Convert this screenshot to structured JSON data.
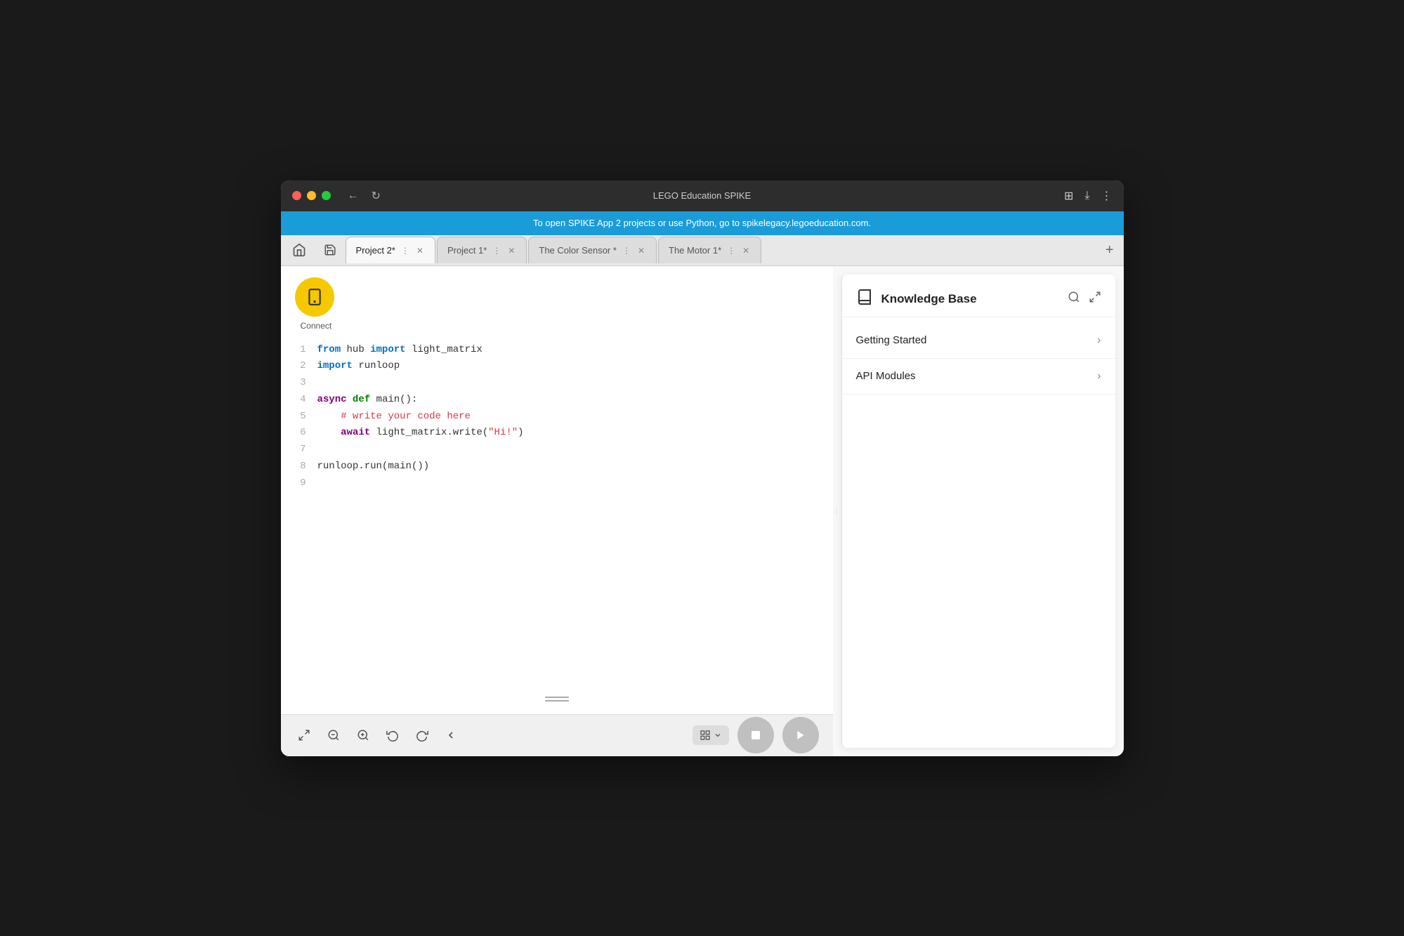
{
  "window": {
    "title": "LEGO Education SPIKE"
  },
  "banner": {
    "text": "To open SPIKE App 2 projects or use Python, go to spikelegacy.legoeducation.com."
  },
  "tabs": [
    {
      "label": "Project 2*",
      "active": true
    },
    {
      "label": "Project 1*",
      "active": false
    },
    {
      "label": "The Color Sensor *",
      "active": false
    },
    {
      "label": "The Motor 1*",
      "active": false
    }
  ],
  "connect": {
    "label": "Connect"
  },
  "code": {
    "lines": [
      {
        "num": "1",
        "content": "from hub import light_matrix"
      },
      {
        "num": "2",
        "content": "import runloop"
      },
      {
        "num": "3",
        "content": ""
      },
      {
        "num": "4",
        "content": "async def main():"
      },
      {
        "num": "5",
        "content": "    # write your code here"
      },
      {
        "num": "6",
        "content": "    await light_matrix.write(\"Hi!\")"
      },
      {
        "num": "7",
        "content": ""
      },
      {
        "num": "8",
        "content": "runloop.run(main())"
      },
      {
        "num": "9",
        "content": ""
      }
    ]
  },
  "knowledge_base": {
    "title": "Knowledge Base",
    "items": [
      {
        "label": "Getting Started"
      },
      {
        "label": "API Modules"
      }
    ]
  },
  "toolbar": {
    "fullscreen": "⤢",
    "zoom_out": "−",
    "zoom_in": "+",
    "undo": "↩",
    "redo": "↪",
    "collapse": "‹"
  }
}
